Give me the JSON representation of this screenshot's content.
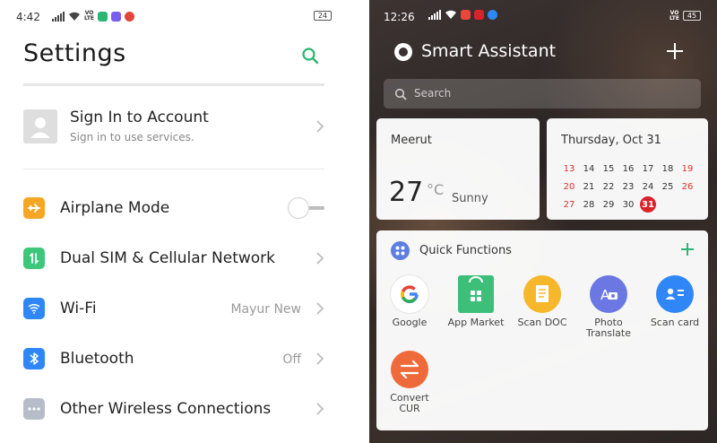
{
  "left_status": {
    "time": "4:42",
    "volte": "VO\nLTE",
    "battery": "24"
  },
  "settings": {
    "title": "Settings",
    "account": {
      "name": "Sign In to Account",
      "subtitle": "Sign in to use services."
    },
    "rows": [
      {
        "label": "Airplane Mode",
        "value": "",
        "icon": "airplane-icon",
        "color": "#f5a623"
      },
      {
        "label": "Dual SIM & Cellular Network",
        "value": "",
        "icon": "sim-icon",
        "color": "#3cc87a"
      },
      {
        "label": "Wi-Fi",
        "value": "Mayur New",
        "icon": "wifi-icon",
        "color": "#2f86f6"
      },
      {
        "label": "Bluetooth",
        "value": "Off",
        "icon": "bluetooth-icon",
        "color": "#2f86f6"
      },
      {
        "label": "Other Wireless Connections",
        "value": "",
        "icon": "more-icon",
        "color": "#b7bdc8"
      }
    ],
    "accent": "#2bb673"
  },
  "right_status": {
    "time": "12:26",
    "volte": "VO\nLTE",
    "battery": "45"
  },
  "assistant": {
    "title": "Smart Assistant",
    "search_placeholder": "Search",
    "weather": {
      "city": "Meerut",
      "temp": "27",
      "unit": "°C",
      "condition": "Sunny"
    },
    "calendar": {
      "header": "Thursday, Oct 31",
      "weeks": [
        [
          {
            "d": "13",
            "red": true
          },
          {
            "d": "14"
          },
          {
            "d": "15"
          },
          {
            "d": "16"
          },
          {
            "d": "17"
          },
          {
            "d": "18"
          },
          {
            "d": "19",
            "red": true
          }
        ],
        [
          {
            "d": "20",
            "red": true
          },
          {
            "d": "21"
          },
          {
            "d": "22"
          },
          {
            "d": "23"
          },
          {
            "d": "24"
          },
          {
            "d": "25"
          },
          {
            "d": "26",
            "red": true
          }
        ],
        [
          {
            "d": "27",
            "red": true
          },
          {
            "d": "28"
          },
          {
            "d": "29"
          },
          {
            "d": "30"
          },
          {
            "d": "31",
            "today": true
          }
        ]
      ]
    },
    "quick_functions": {
      "title": "Quick Functions",
      "items": [
        {
          "label": "Google",
          "icon": "google-icon"
        },
        {
          "label": "App Market",
          "icon": "app-market-icon"
        },
        {
          "label": "Scan DOC",
          "icon": "scan-doc-icon"
        },
        {
          "label": "Photo Translate",
          "icon": "photo-translate-icon"
        },
        {
          "label": "Scan card",
          "icon": "scan-card-icon"
        },
        {
          "label": "Convert CUR",
          "icon": "convert-currency-icon"
        }
      ]
    }
  }
}
